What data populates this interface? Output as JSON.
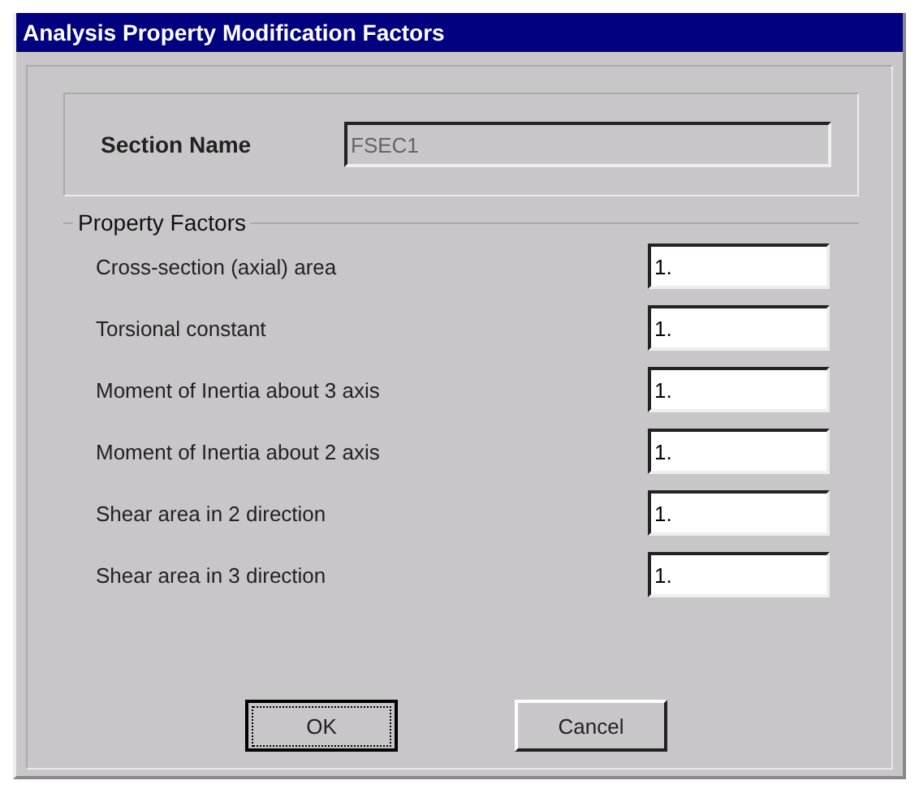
{
  "window": {
    "title": "Analysis Property Modification Factors"
  },
  "section_name": {
    "label": "Section Name",
    "value": "FSEC1",
    "disabled": true
  },
  "property_factors": {
    "title": "Property Factors",
    "rows": [
      {
        "label": "Cross-section (axial) area",
        "value": "1."
      },
      {
        "label": "Torsional constant",
        "value": "1."
      },
      {
        "label": "Moment of Inertia about 3 axis",
        "value": "1."
      },
      {
        "label": "Moment of Inertia about 2 axis",
        "value": "1."
      },
      {
        "label": "Shear area in 2 direction",
        "value": "1."
      },
      {
        "label": "Shear area in 3 direction",
        "value": "1."
      }
    ]
  },
  "buttons": [
    {
      "label": "OK",
      "focused": true
    },
    {
      "label": "Cancel",
      "focused": false
    }
  ]
}
